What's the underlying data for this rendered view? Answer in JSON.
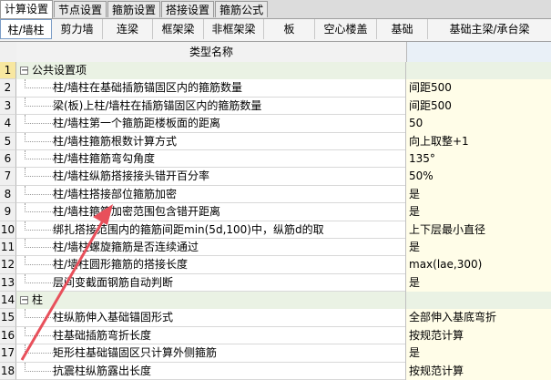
{
  "top_tabs": [
    "计算设置",
    "节点设置",
    "箍筋设置",
    "搭接设置",
    "箍筋公式"
  ],
  "sub_tabs": [
    "柱/墙柱",
    "剪力墙",
    "连梁",
    "框架梁",
    "非框架梁",
    "板",
    "空心楼盖",
    "基础",
    "基础主梁/承台梁"
  ],
  "header": {
    "name_col": "类型名称"
  },
  "rows": [
    {
      "num": "1",
      "name": "公共设置项",
      "value": "",
      "group": true
    },
    {
      "num": "2",
      "name": "柱/墙柱在基础插筋锚固区内的箍筋数量",
      "value": "间距500"
    },
    {
      "num": "3",
      "name": "梁(板)上柱/墙柱在插筋锚固区内的箍筋数量",
      "value": "间距500"
    },
    {
      "num": "4",
      "name": "柱/墙柱第一个箍筋距楼板面的距离",
      "value": "50"
    },
    {
      "num": "5",
      "name": "柱/墙柱箍筋根数计算方式",
      "value": "向上取整+1"
    },
    {
      "num": "6",
      "name": "柱/墙柱箍筋弯勾角度",
      "value": "135°"
    },
    {
      "num": "7",
      "name": "柱/墙柱纵筋搭接接头错开百分率",
      "value": "50%"
    },
    {
      "num": "8",
      "name": "柱/墙柱搭接部位箍筋加密",
      "value": "是"
    },
    {
      "num": "9",
      "name": "柱/墙柱箍筋加密范围包含错开距离",
      "value": "是"
    },
    {
      "num": "10",
      "name": "绑扎搭接范围内的箍筋间距min(5d,100)中，纵筋d的取",
      "value": "上下层最小直径"
    },
    {
      "num": "11",
      "name": "柱/墙柱螺旋箍筋是否连续通过",
      "value": "是"
    },
    {
      "num": "12",
      "name": "柱/墙柱圆形箍筋的搭接长度",
      "value": "max(lae,300)"
    },
    {
      "num": "13",
      "name": "层间变截面钢筋自动判断",
      "value": "是"
    },
    {
      "num": "14",
      "name": "柱",
      "value": "",
      "group": true
    },
    {
      "num": "15",
      "name": "柱纵筋伸入基础锚固形式",
      "value": "全部伸入基底弯折"
    },
    {
      "num": "16",
      "name": "柱基础插筋弯折长度",
      "value": "按规范计算"
    },
    {
      "num": "17",
      "name": "矩形柱基础锚固区只计算外侧箍筋",
      "value": "是"
    },
    {
      "num": "18",
      "name": "抗震柱纵筋露出长度",
      "value": "按规范计算"
    }
  ],
  "colors": {
    "arrow": "#e8505b",
    "value_bg": "#fffde8",
    "group_bg": "#eaf2e4"
  }
}
